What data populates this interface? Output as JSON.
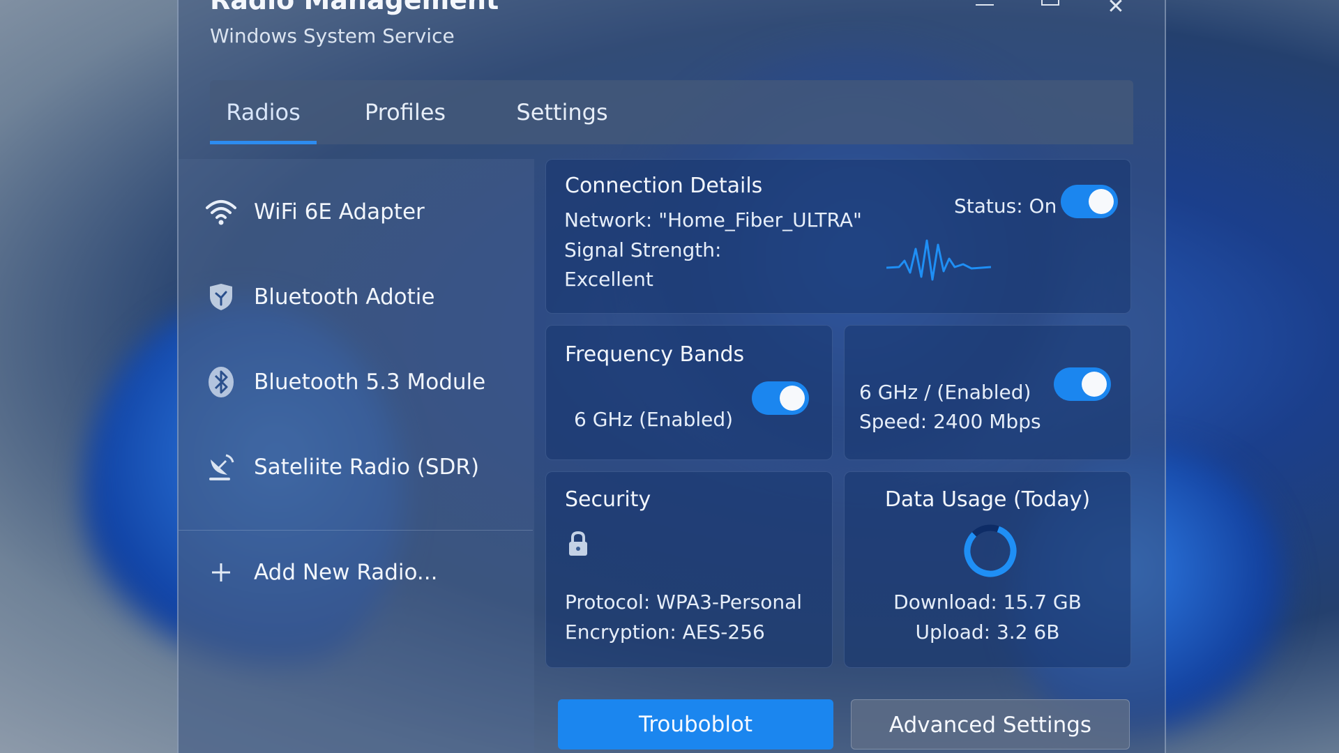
{
  "window": {
    "title": "Radio Management",
    "subtitle": "Windows System Service",
    "controls": {
      "minimize": "",
      "maximize": "",
      "close": "✕"
    }
  },
  "tabs": [
    {
      "label": "Radios",
      "active": true
    },
    {
      "label": "Profiles",
      "active": false
    },
    {
      "label": "Settings",
      "active": false
    }
  ],
  "sidebar": {
    "items": [
      {
        "label": "WiFi 6E Adapter",
        "icon": "wifi-icon"
      },
      {
        "label": "Bluetooth Adotie",
        "icon": "shield-icon"
      },
      {
        "label": "Bluetooth 5.3 Module",
        "icon": "bluetooth-icon"
      },
      {
        "label": "Sateliite Radio (SDR)",
        "icon": "satellite-dish-icon"
      }
    ],
    "add_label": "Add New Radio...",
    "add_icon": "plus-icon"
  },
  "connection": {
    "title": "Connection Details",
    "network": "Network: \"Home_Fiber_ULTRA\"",
    "signal_label": "Signal Strength:",
    "signal_value": "Excellent",
    "status_label": "Status: On",
    "status_on": true
  },
  "frequency": {
    "title": "Frequency Bands",
    "band_a": "6 GHz (Enabled)",
    "band_a_on": true,
    "band_b": "6 GHz / (Enabled)",
    "speed": "Speed: 2400 Mbps",
    "band_b_on": true
  },
  "security": {
    "title": "Security",
    "protocol": "Protocol: WPA3-Personal",
    "encryption": "Encryption: AES-256",
    "icon": "lock-icon"
  },
  "usage": {
    "title": "Data Usage (Today)",
    "download": "Download: 15.7 GB",
    "upload": "Upload: 3.2 6B"
  },
  "buttons": {
    "primary": "Trouboblot",
    "secondary": "Advanced Settings"
  },
  "colors": {
    "accent": "#1b86ef"
  }
}
